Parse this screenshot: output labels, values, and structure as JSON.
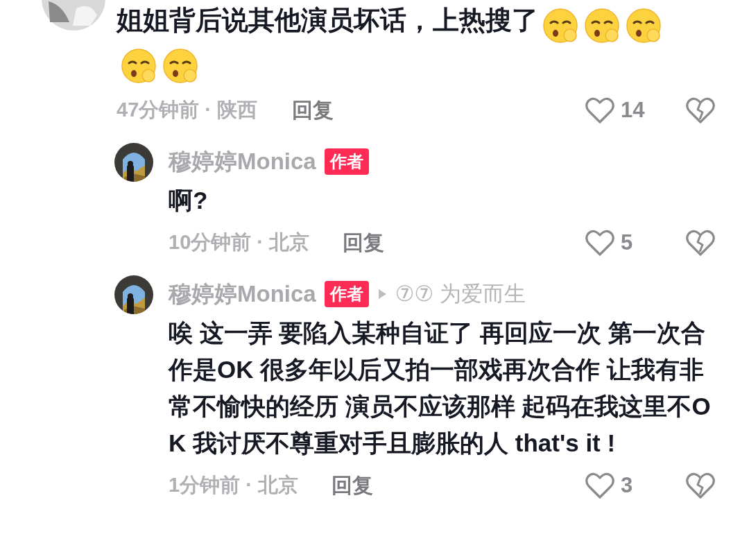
{
  "comments": [
    {
      "kind": "top",
      "text": "姐姐背后说其他演员坏话，上热搜了",
      "emojis": [
        {
          "kind": "shush"
        },
        {
          "kind": "shush"
        },
        {
          "kind": "shush"
        },
        {
          "kind": "shush"
        },
        {
          "kind": "shush"
        }
      ],
      "time": "47分钟前 · 陕西",
      "reply": "回复",
      "likes": "14"
    },
    {
      "kind": "reply",
      "author": "穆婷婷Monica",
      "badge": "作者",
      "text": "啊?",
      "time": "10分钟前 · 北京",
      "reply": "回复",
      "likes": "5"
    },
    {
      "kind": "reply",
      "author": "穆婷婷Monica",
      "badge": "作者",
      "reply_to": "⑦⑦ 为爱而生",
      "text": "唉 这一弄 要陷入某种自证了 再回应一次 第一次合作是OK 很多年以后又拍一部戏再次合作 让我有非常不愉快的经历 演员不应该那样 起码在我这里不OK 我讨厌不尊重对手且膨胀的人 that's it !",
      "time": "1分钟前 · 北京",
      "reply": "回复",
      "likes": "3"
    }
  ]
}
